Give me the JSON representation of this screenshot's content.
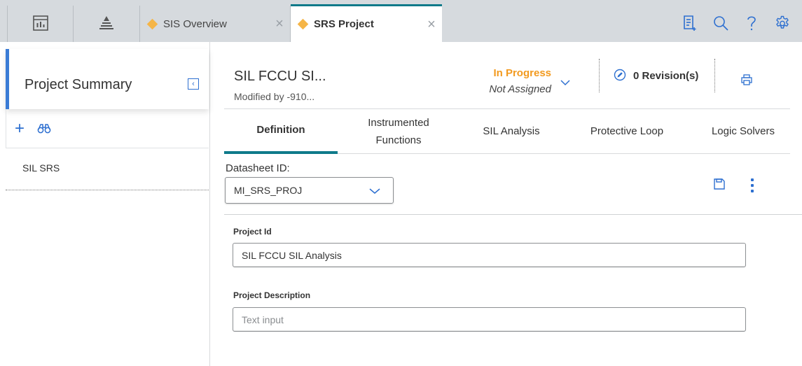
{
  "tabs": {
    "sis_overview": {
      "label": "SIS Overview"
    },
    "srs_project": {
      "label": "SRS Project"
    },
    "close_glyph": "×"
  },
  "left_panel": {
    "title": "Project Summary",
    "collapse_glyph": "‹",
    "add_glyph": "+",
    "items": [
      {
        "label": "SIL SRS"
      }
    ]
  },
  "record": {
    "title": "SIL FCCU SI...",
    "modified_by": "Modified by -910...",
    "status": "In Progress",
    "assignment": "Not Assigned",
    "revisions": "0 Revision(s)"
  },
  "content_tabs": [
    {
      "label": "Definition",
      "active": true
    },
    {
      "label_line1": "Instrumented",
      "label_line2": "Functions"
    },
    {
      "label": "SIL Analysis"
    },
    {
      "label": "Protective Loop"
    },
    {
      "label": "Logic Solvers"
    }
  ],
  "datasheet": {
    "label": "Datasheet ID:",
    "selected": "MI_SRS_PROJ"
  },
  "fields": {
    "project_id": {
      "label": "Project Id",
      "value": "SIL FCCU SIL Analysis"
    },
    "project_description": {
      "label": "Project Description",
      "value": "",
      "placeholder": "Text input"
    }
  },
  "icons": {
    "dashboard": "dashboard-icon",
    "hierarchy": "hierarchy-icon",
    "tab_diamond": "diamond-icon",
    "queue": "queue-icon",
    "search": "search-icon",
    "help": "help-icon",
    "settings": "gear-icon",
    "binoculars": "binoculars-icon",
    "edit": "pencil-circle-icon",
    "print": "print-icon",
    "save": "save-icon",
    "more": "more-vertical-icon"
  },
  "colors": {
    "accent_teal": "#0f7a8a",
    "accent_blue": "#2d6fd0",
    "status_orange": "#f29a1f",
    "tab_diamond": "#f5b547",
    "topbar_bg": "#d6dade"
  }
}
